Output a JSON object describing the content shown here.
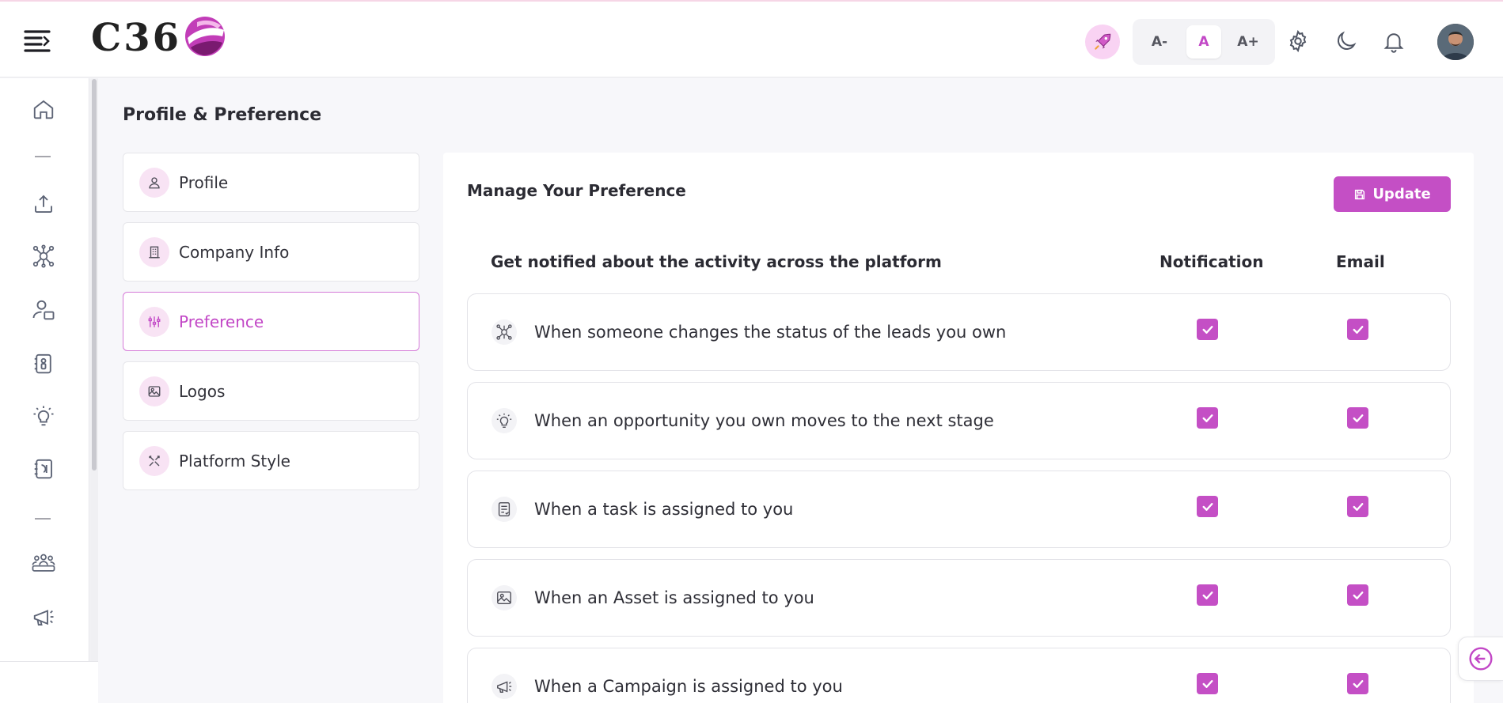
{
  "brand": {
    "logo_text": "C36"
  },
  "header": {
    "font_sizes": [
      {
        "label": "A-",
        "active": false
      },
      {
        "label": "A",
        "active": true
      },
      {
        "label": "A+",
        "active": false
      }
    ],
    "icons": [
      "menu-toggle-icon",
      "rocket-icon",
      "gear-icon",
      "moon-icon",
      "bell-icon"
    ]
  },
  "page": {
    "title": "Profile & Preference"
  },
  "side_menu": {
    "items": [
      {
        "label": "Profile",
        "icon": "user-icon",
        "active": false
      },
      {
        "label": "Company Info",
        "icon": "building-icon",
        "active": false
      },
      {
        "label": "Preference",
        "icon": "sliders-icon",
        "active": true
      },
      {
        "label": "Logos",
        "icon": "image-icon",
        "active": false
      },
      {
        "label": "Platform Style",
        "icon": "tools-icon",
        "active": false
      }
    ]
  },
  "panel": {
    "title": "Manage Your Preference",
    "update_label": "Update",
    "columns": {
      "activity": "Get notified about the activity across the platform",
      "notification": "Notification",
      "email": "Email"
    },
    "rows": [
      {
        "label": "When someone changes the status of the leads you own",
        "icon": "network-icon",
        "notification": true,
        "email": true
      },
      {
        "label": "When an opportunity you own moves to the next stage",
        "icon": "lightbulb-icon",
        "notification": true,
        "email": true
      },
      {
        "label": "When a task is assigned to you",
        "icon": "task-list-icon",
        "notification": true,
        "email": true
      },
      {
        "label": "When an Asset is assigned to you",
        "icon": "image-icon",
        "notification": true,
        "email": true
      },
      {
        "label": "When a Campaign is assigned to you",
        "icon": "megaphone-icon",
        "notification": true,
        "email": true
      }
    ]
  },
  "colors": {
    "accent": "#c44fc5",
    "accent_soft": "#f8e3f4"
  }
}
